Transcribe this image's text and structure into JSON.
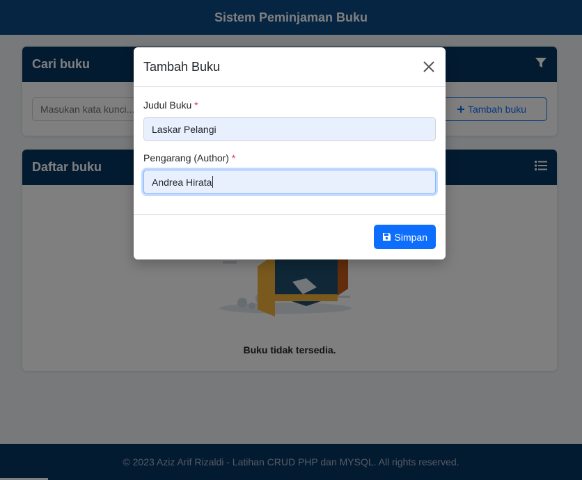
{
  "navbar": {
    "brand": "Sistem Peminjaman Buku"
  },
  "search_card": {
    "title": "Cari buku",
    "filter_icon": "filter-icon",
    "search_placeholder": "Masukan kata kunci...",
    "add_button_label": "Tambah buku",
    "add_icon": "plus-icon"
  },
  "list_card": {
    "title": "Daftar buku",
    "list_icon": "list-icon",
    "empty_text": "Buku tidak tersedia."
  },
  "modal": {
    "title": "Tambah Buku",
    "close_icon": "close-icon",
    "fields": {
      "title_label": "Judul Buku",
      "title_value": "Laskar Pelangi",
      "author_label": "Pengarang (Author)",
      "author_value": "Andrea Hirata",
      "required_mark": "*"
    },
    "save_label": "Simpan",
    "save_icon": "floppy-disk-icon"
  },
  "footer": {
    "text": "© 2023 Aziz Arif Rizaldi - Latihan CRUD PHP dan MYSQL. All rights reserved."
  },
  "colors": {
    "navbar": "#0b4a86",
    "card_header": "#063763",
    "primary": "#0d6efd",
    "required": "#dc3545"
  }
}
